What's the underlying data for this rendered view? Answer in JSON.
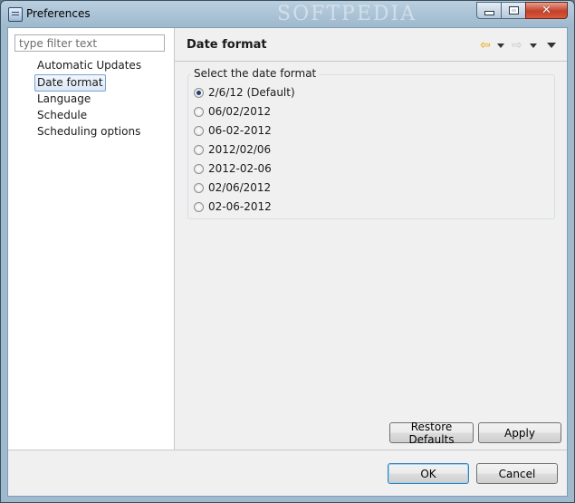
{
  "window": {
    "title": "Preferences",
    "watermark": "SOFTPEDIA"
  },
  "sidebar": {
    "filter_placeholder": "type filter text",
    "items": [
      {
        "label": "Automatic Updates",
        "selected": false
      },
      {
        "label": "Date format",
        "selected": true
      },
      {
        "label": "Language",
        "selected": false
      },
      {
        "label": "Schedule",
        "selected": false
      },
      {
        "label": "Scheduling options",
        "selected": false
      }
    ]
  },
  "page": {
    "title": "Date format",
    "group_label": "Select the date format",
    "options": [
      {
        "label": "2/6/12 (Default)",
        "checked": true
      },
      {
        "label": "06/02/2012",
        "checked": false
      },
      {
        "label": "06-02-2012",
        "checked": false
      },
      {
        "label": "2012/02/06",
        "checked": false
      },
      {
        "label": "2012-02-06",
        "checked": false
      },
      {
        "label": "02/06/2012",
        "checked": false
      },
      {
        "label": "02-06-2012",
        "checked": false
      }
    ],
    "restore_defaults_label": "Restore Defaults",
    "apply_label": "Apply"
  },
  "dialog": {
    "ok_label": "OK",
    "cancel_label": "Cancel"
  },
  "colors": {
    "back_arrow": "#e8a300",
    "forward_arrow_disabled": "#c8c8c8",
    "selection_border": "#7da2ce"
  }
}
